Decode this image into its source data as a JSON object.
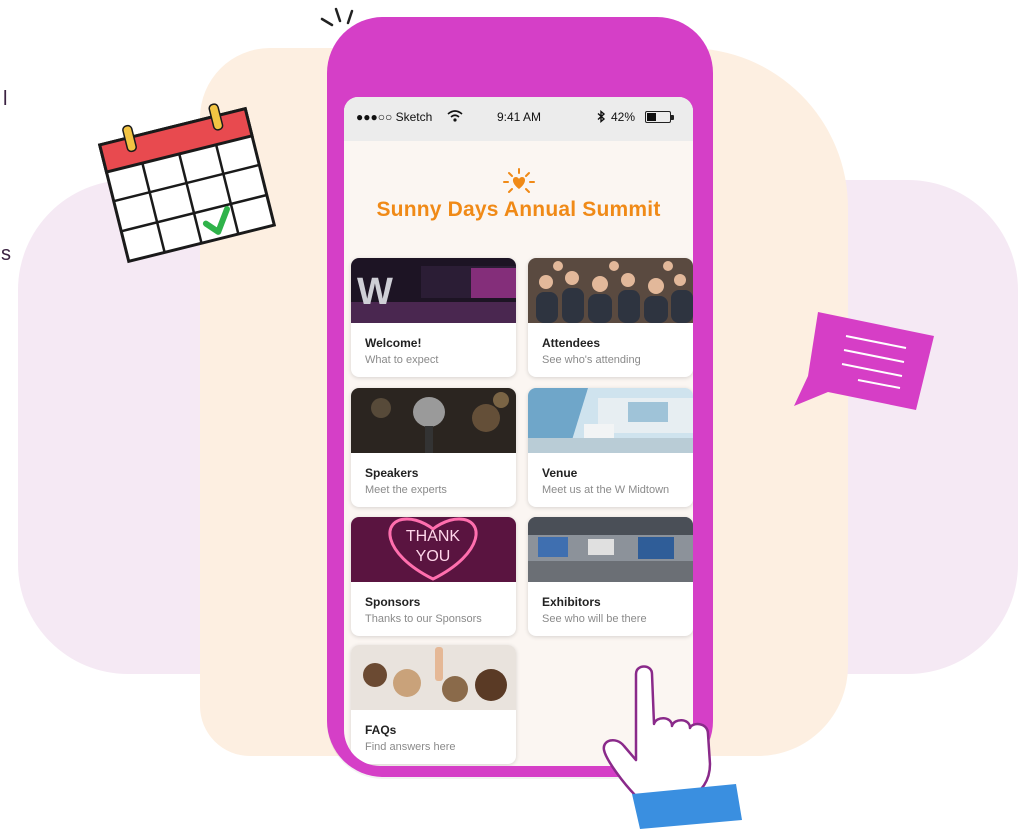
{
  "clipped_left_text": {
    "line1": "l",
    "line2": "s"
  },
  "status_bar": {
    "carrier": "●●●○○ Sketch",
    "wifi_icon": "wifi-icon",
    "time": "9:41 AM",
    "bluetooth_icon": "bluetooth-icon",
    "battery_percent": "42%",
    "battery_level": 0.42
  },
  "app": {
    "title": "Sunny Days Annual Summit",
    "logo_icon": "sun-heart-icon"
  },
  "cards": [
    {
      "title": "Welcome!",
      "subtitle": "What to expect",
      "image": "stage-with-w-sign"
    },
    {
      "title": "Attendees",
      "subtitle": "See who's attending",
      "image": "audience-crowd"
    },
    {
      "title": "Speakers",
      "subtitle": "Meet the experts",
      "image": "microphone"
    },
    {
      "title": "Venue",
      "subtitle": "Meet us at the W Midtown",
      "image": "hotel-lobby"
    },
    {
      "title": "Sponsors",
      "subtitle": "Thanks to our Sponsors",
      "image": "neon-thank-you-heart",
      "image_text": "THANK YOU"
    },
    {
      "title": "Exhibitors",
      "subtitle": "See who will be there",
      "image": "exhibition-hall"
    },
    {
      "title": "FAQs",
      "subtitle": "Find answers here",
      "image": "raised-hand-audience"
    }
  ],
  "decorations": [
    "calendar-check-icon",
    "chat-bubble-icon",
    "pointing-hand-icon"
  ],
  "colors": {
    "phone": "#d53fc7",
    "title": "#f08a17",
    "peach_bg": "#fdefe1",
    "lilac_bg": "#f5e9f4",
    "check": "#2fb34a",
    "calendar_header": "#e84a4f"
  }
}
